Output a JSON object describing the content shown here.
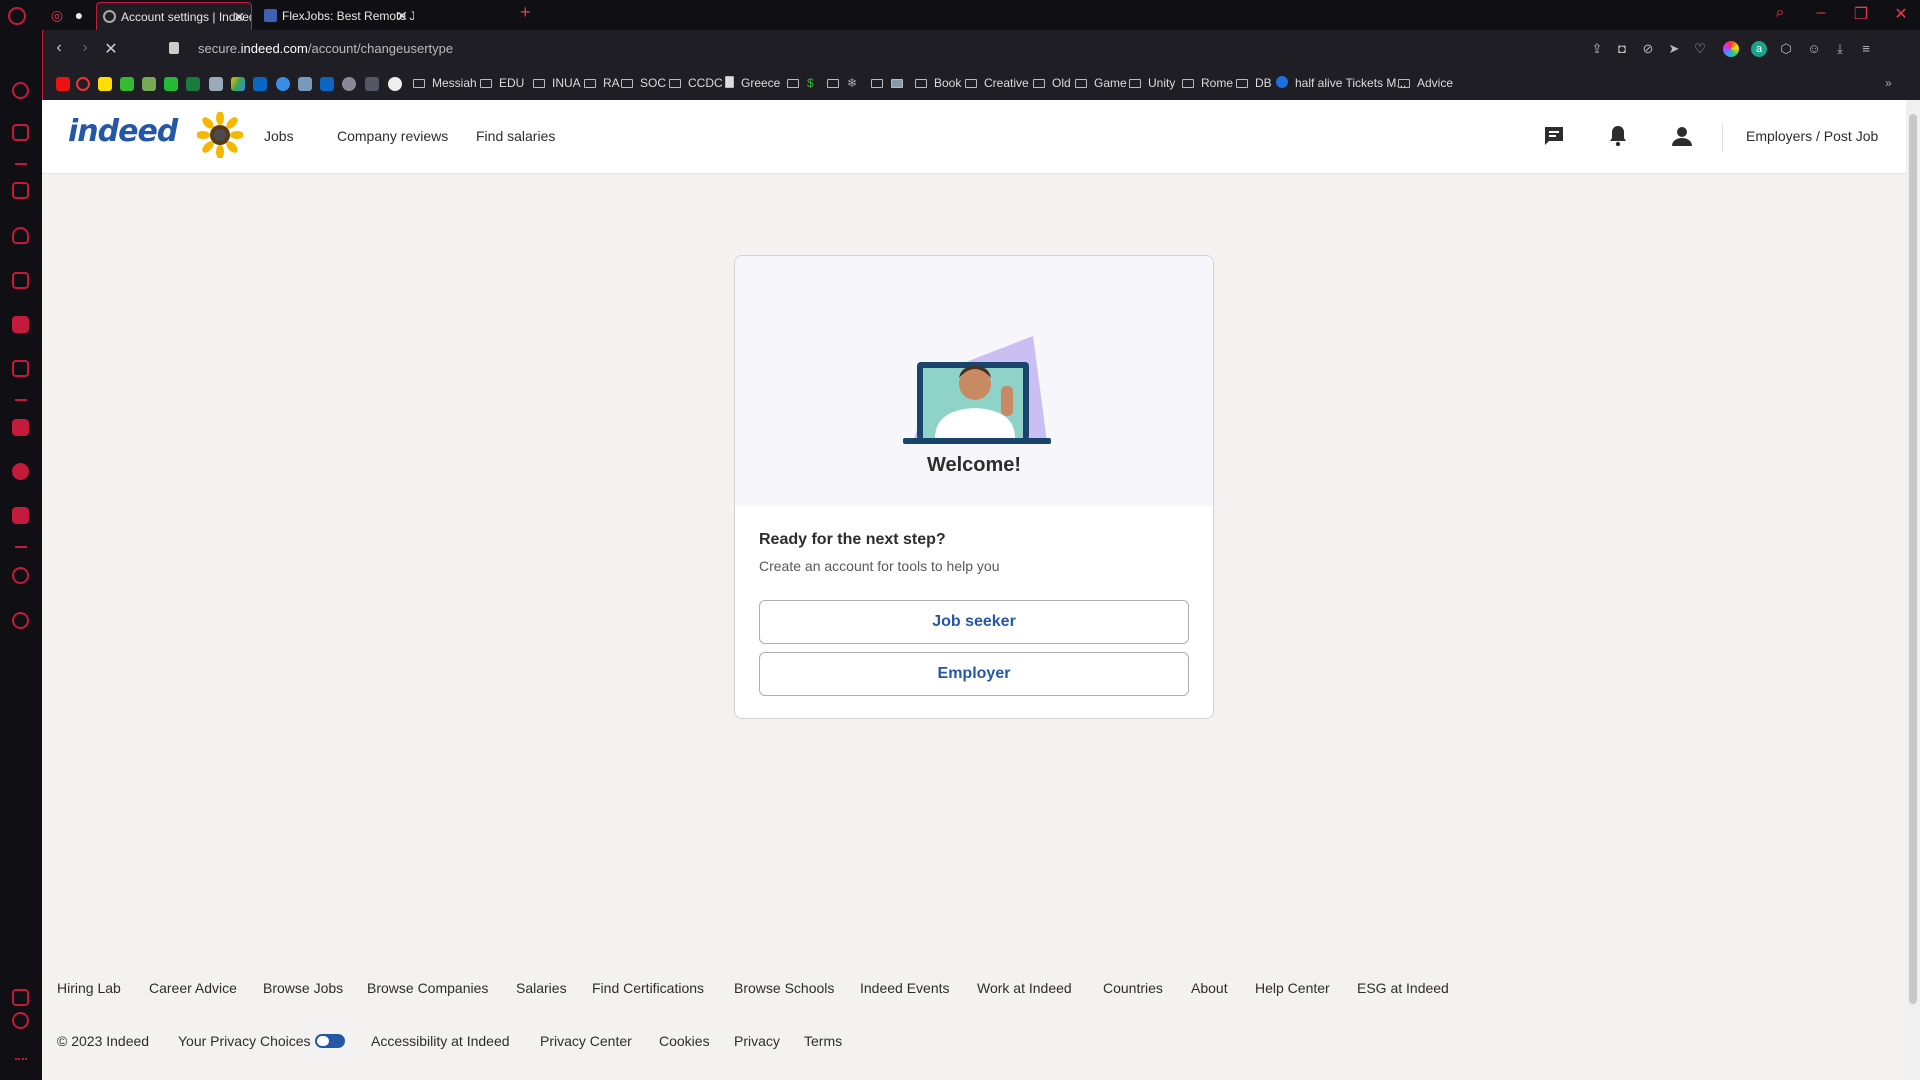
{
  "browser": {
    "tabs": [
      {
        "title": "Account settings | Indeed A",
        "active": true
      },
      {
        "title": "FlexJobs: Best Remote Jobs",
        "active": false
      }
    ],
    "new_tab_label": "+",
    "url_prefix": "secure.",
    "url_domain": "indeed.com",
    "url_path": "/account/changeusertype",
    "bookmarks": [
      "Messiah",
      "EDU",
      "INUA",
      "RA",
      "SOC",
      "CCDC",
      "Greece",
      "Book",
      "Creative",
      "Old",
      "Game",
      "Unity",
      "Rome",
      "DB",
      "half alive Tickets M...",
      "Advice"
    ],
    "accent_color": "#c41a3b"
  },
  "header": {
    "logo_text": "indeed",
    "nav": [
      "Jobs",
      "Company reviews",
      "Find salaries"
    ],
    "employers_link": "Employers / Post Job",
    "brand_color": "#2557a7"
  },
  "card": {
    "welcome": "Welcome!",
    "heading": "Ready for the next step?",
    "subtext": "Create an account for tools to help you",
    "buttons": [
      "Job seeker",
      "Employer"
    ]
  },
  "footer": {
    "links_row1": [
      "Hiring Lab",
      "Career Advice",
      "Browse Jobs",
      "Browse Companies",
      "Salaries",
      "Find Certifications",
      "Browse Schools",
      "Indeed Events",
      "Work at Indeed",
      "Countries",
      "About",
      "Help Center",
      "ESG at Indeed"
    ],
    "copyright": "© 2023 Indeed",
    "links_row2": [
      "Your Privacy Choices",
      "Accessibility at Indeed",
      "Privacy Center",
      "Cookies",
      "Privacy",
      "Terms"
    ]
  }
}
